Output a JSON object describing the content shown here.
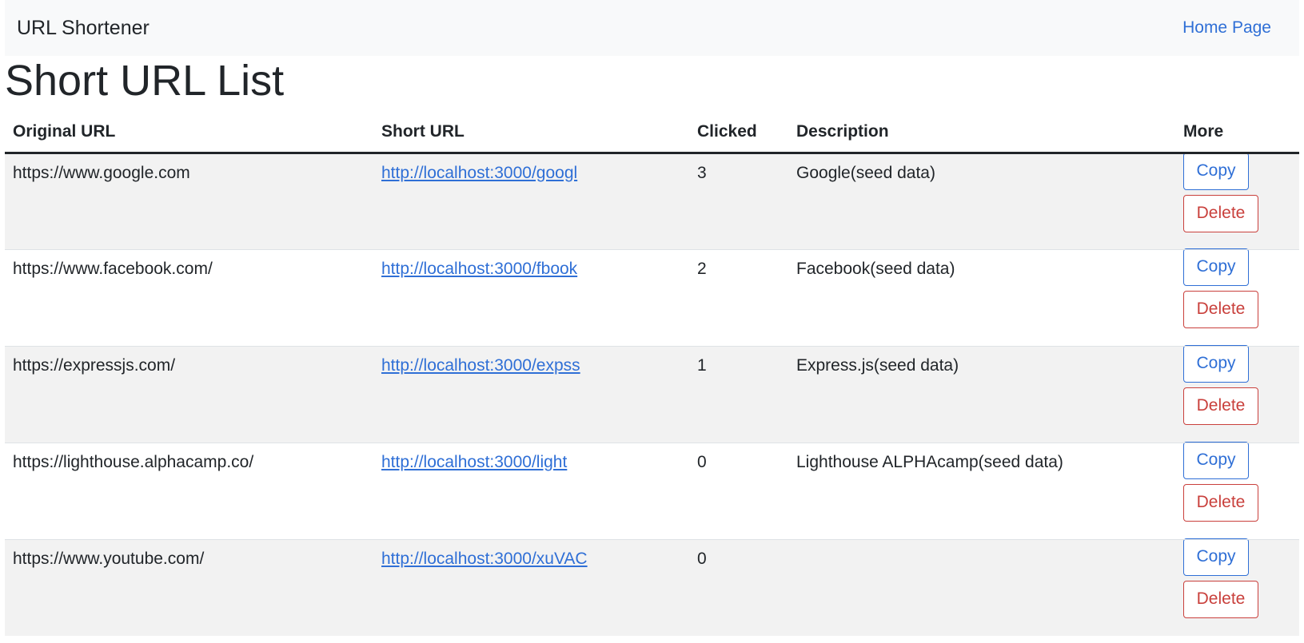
{
  "navbar": {
    "brand": "URL Shortener",
    "home_link": "Home Page"
  },
  "page_title": "Short URL List",
  "table": {
    "headers": [
      "Original URL",
      "Short URL",
      "Clicked",
      "Description",
      "More"
    ],
    "copy_label": "Copy",
    "delete_label": "Delete",
    "rows": [
      {
        "original": "https://www.google.com",
        "short": "http://localhost:3000/googl",
        "clicked": "3",
        "description": "Google(seed data)"
      },
      {
        "original": "https://www.facebook.com/",
        "short": "http://localhost:3000/fbook",
        "clicked": "2",
        "description": "Facebook(seed data)"
      },
      {
        "original": "https://expressjs.com/",
        "short": "http://localhost:3000/expss",
        "clicked": "1",
        "description": "Express.js(seed data)"
      },
      {
        "original": "https://lighthouse.alphacamp.co/",
        "short": "http://localhost:3000/light",
        "clicked": "0",
        "description": "Lighthouse ALPHAcamp(seed data)"
      },
      {
        "original": "https://www.youtube.com/",
        "short": "http://localhost:3000/xuVAC",
        "clicked": "0",
        "description": ""
      }
    ]
  },
  "colors": {
    "link": "#2f6fd6",
    "danger": "#c9403c",
    "navbar_bg": "#f8f9fa",
    "stripe_bg": "#f2f2f2"
  }
}
